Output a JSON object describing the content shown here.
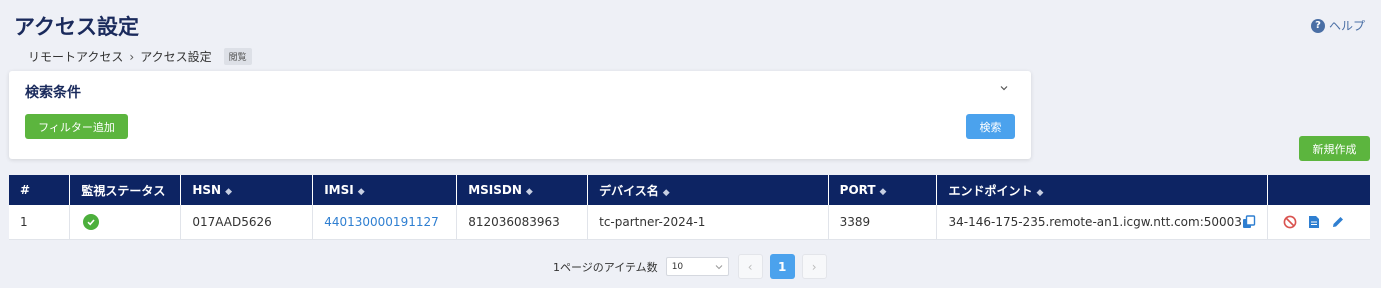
{
  "page": {
    "title": "アクセス設定",
    "help_label": "ヘルプ"
  },
  "breadcrumb": {
    "items": [
      "リモートアクセス",
      "アクセス設定"
    ],
    "badge": "閲覧"
  },
  "search": {
    "title": "検索条件",
    "add_filter_label": "フィルター追加",
    "search_label": "検索"
  },
  "toolbar": {
    "new_label": "新規作成"
  },
  "table": {
    "columns": [
      "#",
      "監視ステータス",
      "HSN",
      "IMSI",
      "MSISDN",
      "デバイス名",
      "PORT",
      "エンドポイント",
      ""
    ],
    "rows": [
      {
        "index": "1",
        "status": "ok",
        "hsn": "017AAD5626",
        "imsi": "440130000191127",
        "msisdn": "812036083963",
        "device_name": "tc-partner-2024-1",
        "port": "3389",
        "endpoint": "34-146-175-235.remote-an1.icgw.ntt.com:50003"
      }
    ]
  },
  "pagination": {
    "items_per_page_label": "1ページのアイテム数",
    "page_size": "10",
    "current_page": "1",
    "prev_symbol": "‹",
    "next_symbol": "›"
  },
  "colors": {
    "header_bg": "#0d2463",
    "primary_green": "#5cb53e",
    "primary_blue": "#4ba2ed",
    "link": "#2f7fd1",
    "delete_red": "#d9534f"
  }
}
